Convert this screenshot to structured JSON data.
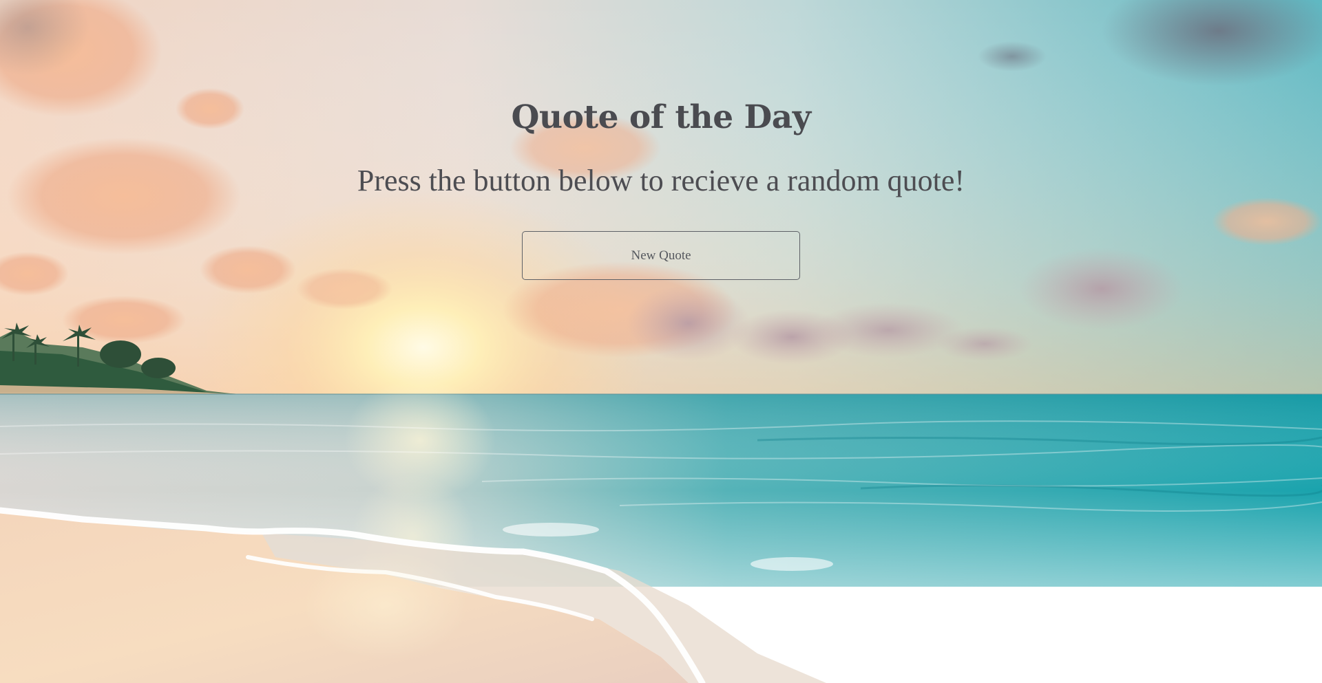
{
  "page": {
    "title": "Quote of the Day",
    "subtitle": "Press the button below to recieve a random quote!",
    "new_quote_label": "New Quote"
  },
  "background": {
    "scene": "beach-sunset-photo",
    "colors": {
      "sky_left": "#f3dcc8",
      "sky_right": "#63bcc4",
      "sun": "#fff3c4",
      "sea_deep": "#2ea9b0",
      "sea_light": "#9fd7d4",
      "sand": "#f0d2b6",
      "foam": "#ffffff",
      "cloud": "#f1b898"
    }
  },
  "text_color": "#4a4b50"
}
